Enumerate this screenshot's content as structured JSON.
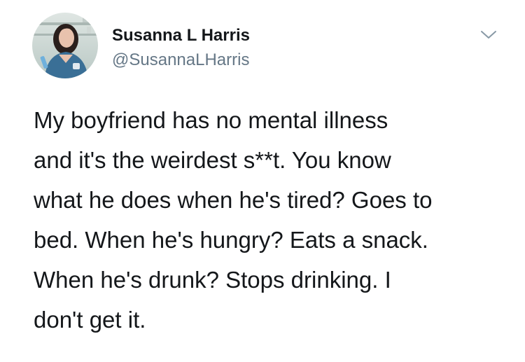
{
  "author": {
    "name": "Susanna L Harris",
    "handle": "@SusannaLHarris",
    "avatar_icon": "profile-photo"
  },
  "menu": {
    "icon": "chevron-down-icon"
  },
  "tweet": {
    "lines": [
      "My boyfriend has no mental illness",
      "and it's the weirdest s**t. You know",
      "what he does when he's tired? Goes to",
      "bed. When he's hungry? Eats a snack.",
      "When he's drunk? Stops drinking. I",
      "don't get it."
    ]
  },
  "colors": {
    "text": "#14171a",
    "secondary": "#657786",
    "chevron": "#8899a6"
  }
}
